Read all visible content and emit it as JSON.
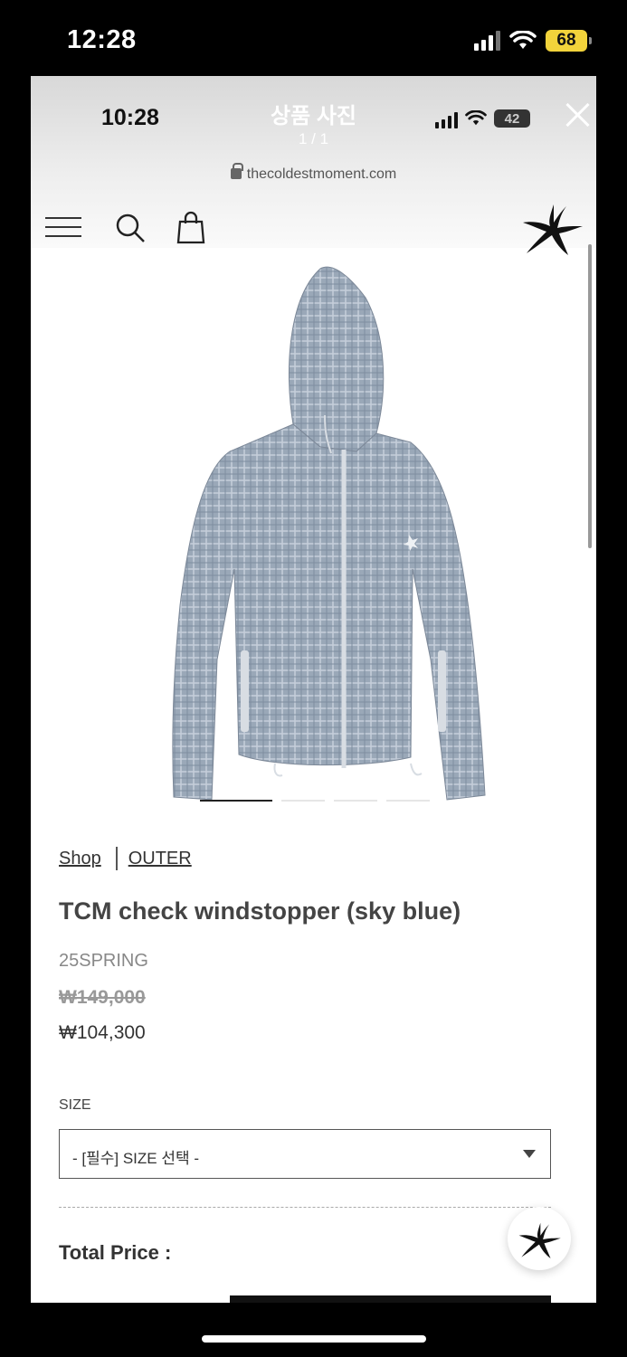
{
  "phone": {
    "time": "12:28",
    "battery": "68"
  },
  "viewer": {
    "title": "상품 사진",
    "count": "1 / 1",
    "inner_time": "10:28",
    "inner_battery": "42",
    "url": "thecoldestmoment.com"
  },
  "breadcrumb": {
    "shop": "Shop",
    "category": "OUTER"
  },
  "product": {
    "title": "TCM check windstopper (sky blue)",
    "season": "25SPRING",
    "original_price": "₩149,000",
    "price": "₩104,300"
  },
  "options": {
    "size_label": "SIZE",
    "size_selected": "- [필수] SIZE 선택 -"
  },
  "total": {
    "label": "Total Price :"
  },
  "carousel": {
    "count": 4,
    "active_index": 0
  },
  "colors": {
    "battery_yellow": "#f2d33b",
    "jacket_blue": "#9aa8b8"
  }
}
